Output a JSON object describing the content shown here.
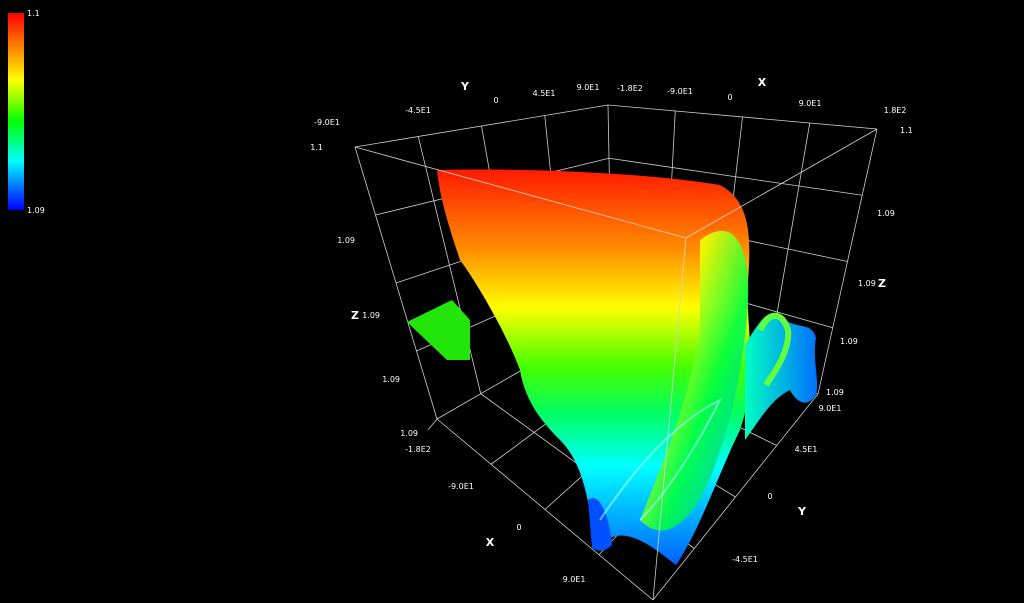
{
  "chart_data": {
    "type": "surface3d",
    "title": "",
    "colorbar": {
      "max_label": "1.1",
      "min_label": "1.09",
      "colors": [
        "#ff0000",
        "#ffff00",
        "#00ff00",
        "#00ffff",
        "#0000ff"
      ]
    },
    "x_axis": {
      "name": "X",
      "range": [
        -180,
        180
      ],
      "ticks_back": [
        "-1.8E2",
        "-9.0E1",
        "0",
        "9.0E1",
        "1.8E2"
      ],
      "ticks_front": [
        "-1.8E2",
        "-9.0E1",
        "0",
        "9.0E1"
      ]
    },
    "y_axis": {
      "name": "Y",
      "range": [
        -90,
        90
      ],
      "ticks_back": [
        "-9.0E1",
        "-4.5E1",
        "0",
        "4.5E1",
        "9.0E1"
      ],
      "ticks_front": [
        "9.0E1",
        "4.5E1",
        "0",
        "-4.5E1"
      ]
    },
    "z_axis": {
      "name": "Z",
      "range": [
        1.09,
        1.1
      ],
      "ticks_left": [
        "1.1",
        "1.09",
        "1.09",
        "1.09",
        "1.09"
      ],
      "ticks_right": [
        "1.1",
        "1.09",
        "1.09",
        "1.09",
        "1.09"
      ]
    },
    "background": "#000000",
    "grid": true
  }
}
